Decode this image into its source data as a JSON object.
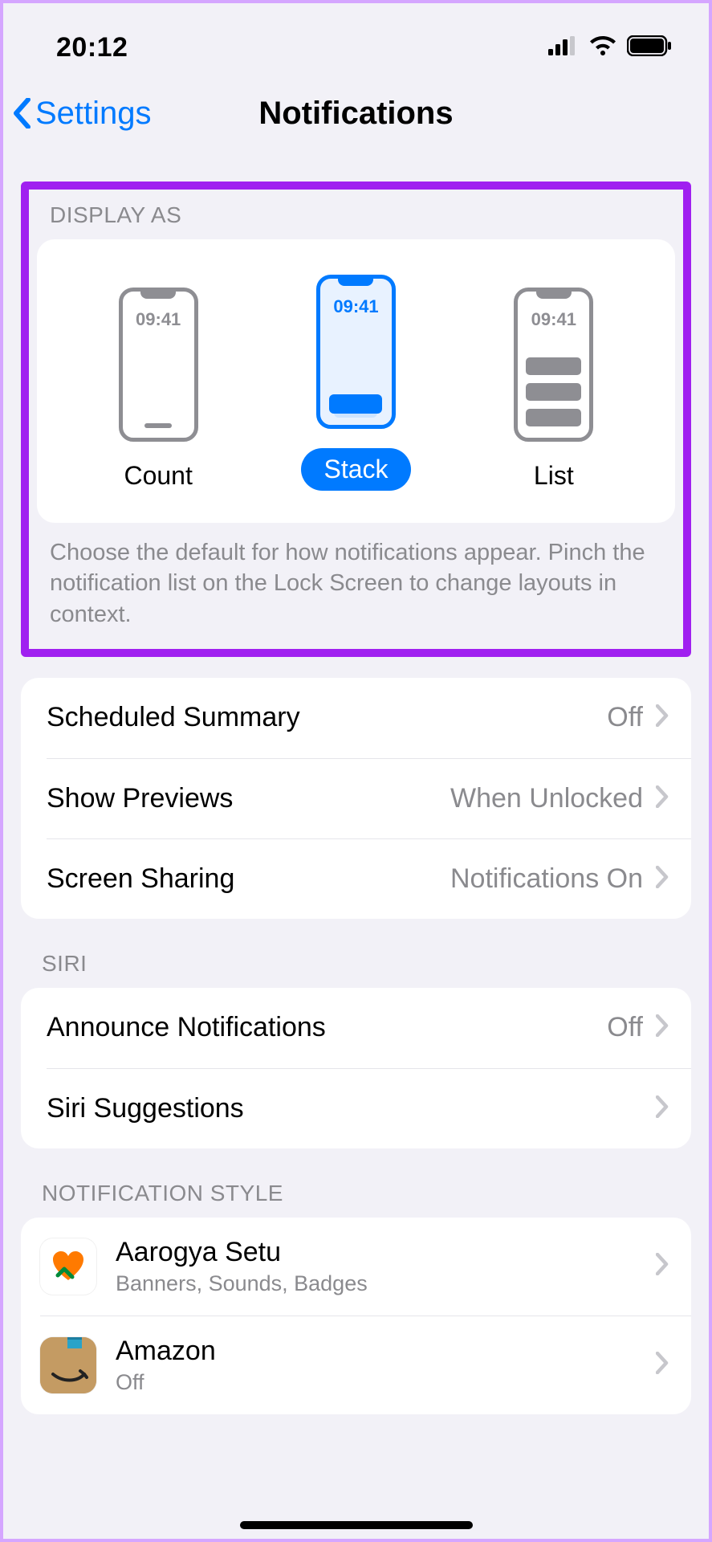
{
  "status": {
    "time": "20:12"
  },
  "nav": {
    "back": "Settings",
    "title": "Notifications"
  },
  "display": {
    "header": "DISPLAY AS",
    "phone_time": "09:41",
    "options": [
      "Count",
      "Stack",
      "List"
    ],
    "selected": "Stack",
    "footer": "Choose the default for how notifications appear. Pinch the notification list on the Lock Screen to change layouts in context."
  },
  "general_rows": [
    {
      "label": "Scheduled Summary",
      "value": "Off"
    },
    {
      "label": "Show Previews",
      "value": "When Unlocked"
    },
    {
      "label": "Screen Sharing",
      "value": "Notifications On"
    }
  ],
  "siri": {
    "header": "SIRI",
    "rows": [
      {
        "label": "Announce Notifications",
        "value": "Off"
      },
      {
        "label": "Siri Suggestions",
        "value": ""
      }
    ]
  },
  "style": {
    "header": "NOTIFICATION STYLE",
    "apps": [
      {
        "name": "Aarogya Setu",
        "sub": "Banners, Sounds, Badges",
        "icon": "aarogya"
      },
      {
        "name": "Amazon",
        "sub": "Off",
        "icon": "amazon"
      }
    ]
  }
}
